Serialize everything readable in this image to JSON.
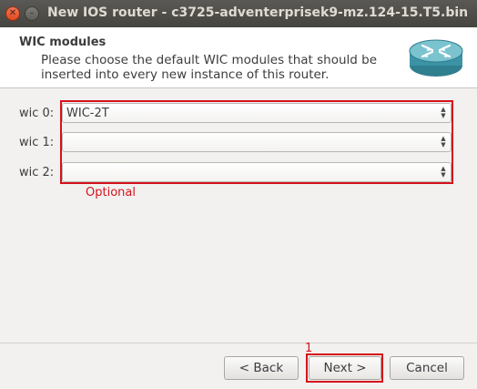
{
  "window": {
    "title": "New IOS router - c3725-adventerprisek9-mz.124-15.T5.bin"
  },
  "header": {
    "title": "WIC modules",
    "subtitle": "Please choose the default WIC modules that should be inserted into every new instance of this router."
  },
  "wics": [
    {
      "label": "wic 0:",
      "value": "WIC-2T"
    },
    {
      "label": "wic 1:",
      "value": ""
    },
    {
      "label": "wic 2:",
      "value": ""
    }
  ],
  "annotations": {
    "optional": "Optional",
    "step": "1",
    "color": "#d6111b"
  },
  "buttons": {
    "back": "< Back",
    "next": "Next >",
    "cancel": "Cancel"
  }
}
